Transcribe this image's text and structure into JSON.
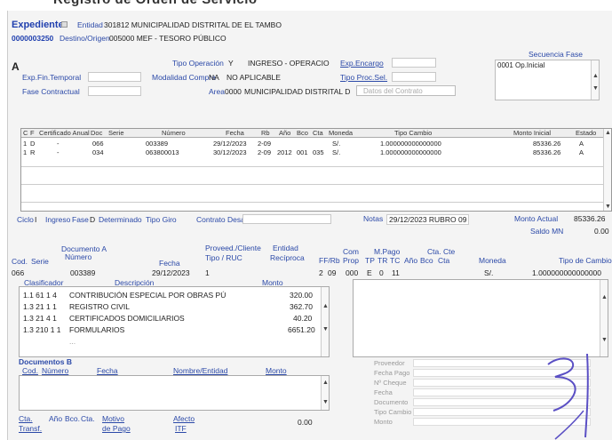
{
  "caption": "Registro de Orden de Servicio",
  "header": {
    "title": "Expediente",
    "expediente_no": "0000003250",
    "entidad_label": "Entidad",
    "entidad_value": "301812 MUNICIPALIDAD DISTRITAL DE EL TAMBO",
    "destino_label": "Destino/Origen",
    "destino_value": "005000 MEF - TESORO PÚBLICO"
  },
  "form": {
    "fase_code": "A",
    "tipo_operacion_label": "Tipo Operación",
    "tipo_operacion_code": "Y",
    "tipo_operacion_value": "INGRESO - OPERACIO",
    "exp_encargo_label": "Exp.Encargo",
    "exp_fin_temporal_label": "Exp.Fin.Temporal",
    "modalidad_label": "Modalidad Compra",
    "modalidad_code": "NA",
    "modalidad_value": "NO APLICABLE",
    "tipo_proc_sel_label": "Tipo Proc.Sel.",
    "fase_contractual_label": "Fase Contractual",
    "area_label": "Area",
    "area_code": "0000",
    "area_value": "MUNICIPALIDAD DISTRITAL D",
    "datos_contrato_label": "Datos del Contrato",
    "secuencia_fase_label": "Secuencia Fase",
    "secuencia_fase_value": "0001 Op.Inicial"
  },
  "grid": {
    "headers": [
      "C",
      "F",
      "Certificado Anual",
      "Doc",
      "Serie",
      "Número",
      "Fecha",
      "Rb",
      "Año",
      "Bco",
      "Cta",
      "Moneda",
      "Tipo Cambio",
      "Monto Inicial",
      "Estado"
    ],
    "rows": [
      {
        "c": "1",
        "f": "D",
        "cert": "-",
        "doc": "066",
        "serie": "",
        "numero": "003389",
        "fecha": "29/12/2023",
        "rb": "2-09",
        "anio": "",
        "bco": "",
        "cta": "",
        "moneda": "S/.",
        "tc": "1.000000000000000",
        "monto": "85336.26",
        "estado": "A"
      },
      {
        "c": "1",
        "f": "R",
        "cert": "-",
        "doc": "034",
        "serie": "",
        "numero": "063800013",
        "fecha": "30/12/2023",
        "rb": "2-09",
        "anio": "2012",
        "bco": "001",
        "cta": "035",
        "moneda": "S/.",
        "tc": "1.000000000000000",
        "monto": "85336.26",
        "estado": "A"
      }
    ]
  },
  "status": {
    "ciclo_label": "Ciclo",
    "ciclo_value": "I",
    "ciclo_desc": "Ingreso",
    "fase_label": "Fase",
    "fase_value": "D",
    "fase_desc": "Determinado",
    "tipo_giro_label": "Tipo Giro",
    "contrato_label": "Contrato Desafe",
    "notas_label": "Notas",
    "notas_value": "29/12/2023 RUBRO 09",
    "monto_actual_label": "Monto Actual",
    "monto_actual_value": "85336.26",
    "saldo_label": "Saldo MN",
    "saldo_value": "0.00"
  },
  "documento": {
    "section_label": "Documento A",
    "cod_label": "Cod.",
    "serie_label": "Serie",
    "numero_label": "Número",
    "fecha_label": "Fecha",
    "tipo_ruc_label": "Tipo / RUC",
    "proveed_label": "Proveed./Cliente",
    "entidad_label": "Entidad",
    "reciproca_label": "Recíproca",
    "ffrb_label": "FF/Rb",
    "fteg_label": "Prop",
    "tp_label": "TP",
    "tr_label": "TR",
    "tc_label": "TC",
    "com_label": "Com",
    "mpago_label": "M.Pago",
    "ano_label": "Año",
    "bco_label": "Bco",
    "cta_label": "Cta",
    "cta_cte_label": "Cta. Cte",
    "moneda_label": "Moneda",
    "tipo_cambio_label": "Tipo de Cambio",
    "cod_value": "066",
    "numero_value": "003389",
    "fecha_value": "29/12/2023",
    "tipo_value": "1",
    "ffrb_value": "2",
    "rb_value": "09",
    "prop_value": "000",
    "tp_value": "E",
    "tr_value": "0",
    "tc_value": "11",
    "moneda_value": "S/.",
    "tipo_cambio_value": "1.000000000000000"
  },
  "clasificador": {
    "header_label": "Clasificador",
    "desc_label": "Descripción",
    "monto_label": "Monto",
    "rows": [
      {
        "code": "1.1 61 1 4",
        "desc": "CONTRIBUCIÓN ESPECIAL POR OBRAS PÚ",
        "monto": "320.00"
      },
      {
        "code": "1.3 21 1 1",
        "desc": "REGISTRO CIVIL",
        "monto": "362.70"
      },
      {
        "code": "1.3 21 4 1",
        "desc": "CERTIFICADOS DOMICILIARIOS",
        "monto": "40.20"
      },
      {
        "code": "1.3 210 1 1",
        "desc": "FORMULARIOS",
        "monto": "6651.20"
      },
      {
        "code": "",
        "desc": "...",
        "monto": ""
      }
    ]
  },
  "documentos_b": {
    "header_label": "Documentos B",
    "cod_label": "Cod.",
    "numero_label": "Número",
    "fecha_label": "Fecha",
    "nombre_label": "Nombre/Entidad",
    "monto_label": "Monto"
  },
  "footer": {
    "cta_label": "Cta.",
    "transf_label": "Transf.",
    "ano_label": "Año",
    "bco_label": "Bco.",
    "cta2_label": "Cta.",
    "motivo_label": "Motivo",
    "de_pago_label": "de Pago",
    "afecto_label": "Afecto",
    "itf_label": "ITF",
    "total_value": "0.00"
  },
  "right_panel": {
    "labels": [
      "Proveedor",
      "Fecha Pago",
      "Nº Cheque",
      "Fecha",
      "Documento",
      "Tipo Cambio",
      "Monto"
    ]
  }
}
